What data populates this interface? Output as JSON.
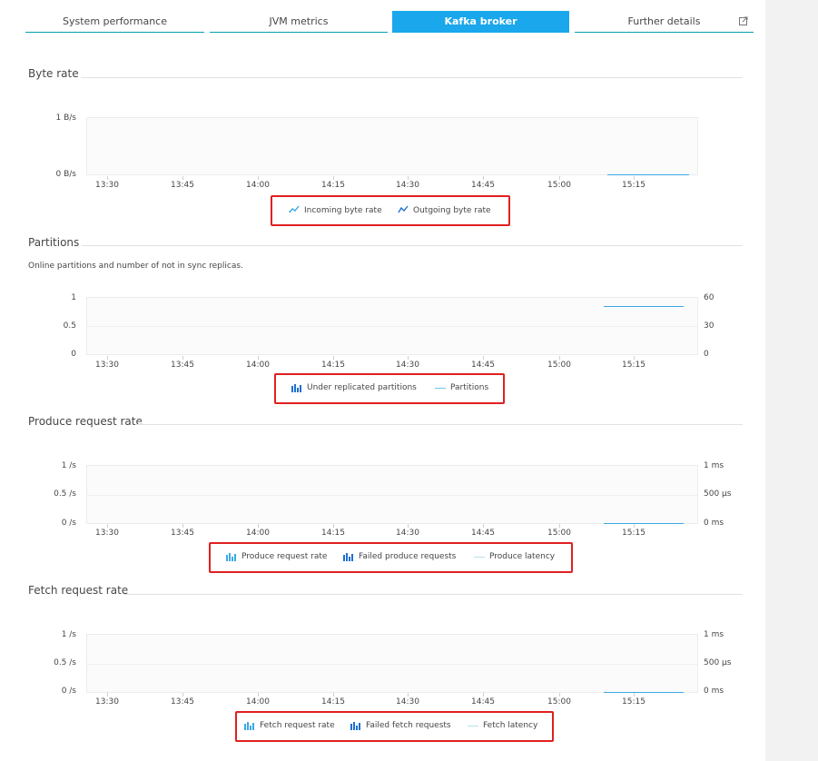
{
  "tabs": [
    {
      "label": "System performance"
    },
    {
      "label": "JVM metrics"
    },
    {
      "label": "Kafka broker",
      "active": true
    },
    {
      "label": "Further details"
    }
  ],
  "x_ticks": [
    "13:30",
    "13:45",
    "14:00",
    "14:15",
    "14:30",
    "14:45",
    "15:00",
    "15:15"
  ],
  "sections": {
    "byte_rate": {
      "title": "Byte rate",
      "y_left": [
        "1 B/s",
        "0 B/s"
      ],
      "legend": [
        "Incoming byte rate",
        "Outgoing byte rate"
      ]
    },
    "partitions": {
      "title": "Partitions",
      "description": "Online partitions and number of not in sync replicas.",
      "y_left": [
        "1",
        "0.5",
        "0"
      ],
      "y_right": [
        "60",
        "30",
        "0"
      ],
      "legend": [
        "Under replicated partitions",
        "Partitions"
      ]
    },
    "produce": {
      "title": "Produce request rate",
      "y_left": [
        "1 /s",
        "0.5 /s",
        "0 /s"
      ],
      "y_right": [
        "1 ms",
        "500 µs",
        "0 ms"
      ],
      "legend": [
        "Produce request rate",
        "Failed produce requests",
        "Produce latency"
      ]
    },
    "fetch": {
      "title": "Fetch request rate",
      "y_left": [
        "1 /s",
        "0.5 /s",
        "0 /s"
      ],
      "y_right": [
        "1 ms",
        "500 µs",
        "0 ms"
      ],
      "legend": [
        "Fetch request rate",
        "Failed fetch requests",
        "Fetch latency"
      ]
    }
  },
  "colors": {
    "accent": "#1aa7ec",
    "series": "#3aa9e6",
    "bar_icon": "#1f6fd1",
    "highlight": "#e02020"
  }
}
